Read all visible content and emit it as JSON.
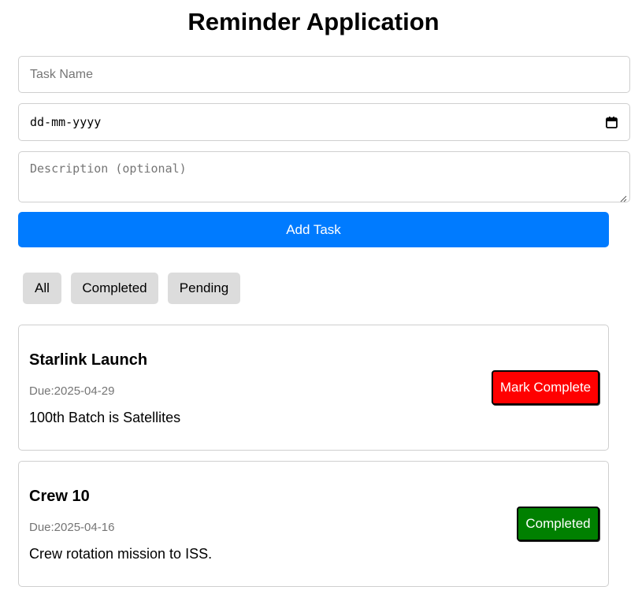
{
  "app": {
    "title": "Reminder Application"
  },
  "form": {
    "task_name_placeholder": "Task Name",
    "date_placeholder": "dd-mm-yyyy",
    "description_placeholder": "Description (optional)",
    "add_button_label": "Add Task"
  },
  "filters": [
    {
      "label": "All"
    },
    {
      "label": "Completed"
    },
    {
      "label": "Pending"
    }
  ],
  "tasks": [
    {
      "title": "Starlink Launch",
      "due": "Due:2025-04-29",
      "description": "100th Batch is Satellites",
      "action_label": "Mark Complete",
      "action_color": "#ff0000"
    },
    {
      "title": "Crew 10",
      "due": "Due:2025-04-16",
      "description": "Crew rotation mission to ISS.",
      "action_label": "Completed",
      "action_color": "#008000"
    }
  ],
  "colors": {
    "accent": "#007bff",
    "filter_bg": "#dcdcdc"
  },
  "icons": {
    "date": "calendar-icon",
    "textarea": "resize-handle-icon"
  }
}
